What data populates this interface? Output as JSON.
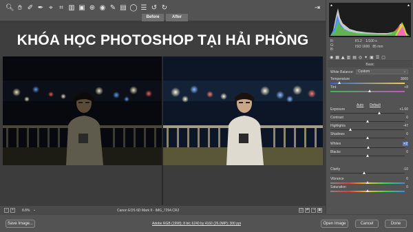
{
  "toolbar": {
    "tools": [
      "zoom-icon",
      "hand-icon",
      "white-balance-icon",
      "color-sampler-icon",
      "target-adjust-icon",
      "crop-icon",
      "straighten-icon",
      "transform-icon",
      "spot-removal-icon",
      "red-eye-icon",
      "adjustment-brush-icon",
      "graduated-filter-icon",
      "radial-filter-icon",
      "preferences-icon",
      "rotate-ccw-icon",
      "rotate-cw-icon"
    ],
    "right_tool": "open-panel-icon"
  },
  "view_tabs": {
    "before": "Before",
    "after": "After"
  },
  "banner": {
    "title": "KHÓA HỌC PHOTOSHOP TẠI HẢI PHÒNG"
  },
  "status": {
    "zoom": "8.8%",
    "filename": "Canon EOS 6D Mark II  -  IMG_7294.CR2"
  },
  "bottom": {
    "save": "Save Image...",
    "workflow": "Adobe RGB (1998); 8 bit; 6240 by 4160 (26.0MP); 300 ppi",
    "open": "Open Image",
    "cancel": "Cancel",
    "done": "Done"
  },
  "exif": {
    "r": "R:",
    "g": "G:",
    "b": "B:",
    "aperture": "f/1.2",
    "shutter": "1/100 s",
    "iso": "ISO 1600",
    "focal": "85 mm"
  },
  "panel": {
    "section": "Basic",
    "wb_label": "White Balance:",
    "wb_value": "Custom",
    "auto": "Auto",
    "default": "Default",
    "sliders": [
      {
        "label": "Temperature",
        "value": "3000",
        "pos": 0.12
      },
      {
        "label": "Tint",
        "value": "+8",
        "pos": 0.53
      },
      {
        "label": "Exposure",
        "value": "+1.60",
        "pos": 0.66
      },
      {
        "label": "Contrast",
        "value": "0",
        "pos": 0.5
      },
      {
        "label": "Highlights",
        "value": "-47",
        "pos": 0.27
      },
      {
        "label": "Shadows",
        "value": "0",
        "pos": 0.5
      },
      {
        "label": "Whites",
        "value": "+2",
        "pos": 0.51,
        "highlight": true
      },
      {
        "label": "Blacks",
        "value": "0",
        "pos": 0.5
      },
      {
        "label": "Clarity",
        "value": "-10",
        "pos": 0.45
      },
      {
        "label": "Vibrance",
        "value": "0",
        "pos": 0.5
      },
      {
        "label": "Saturation",
        "value": "0",
        "pos": 0.5
      }
    ]
  }
}
